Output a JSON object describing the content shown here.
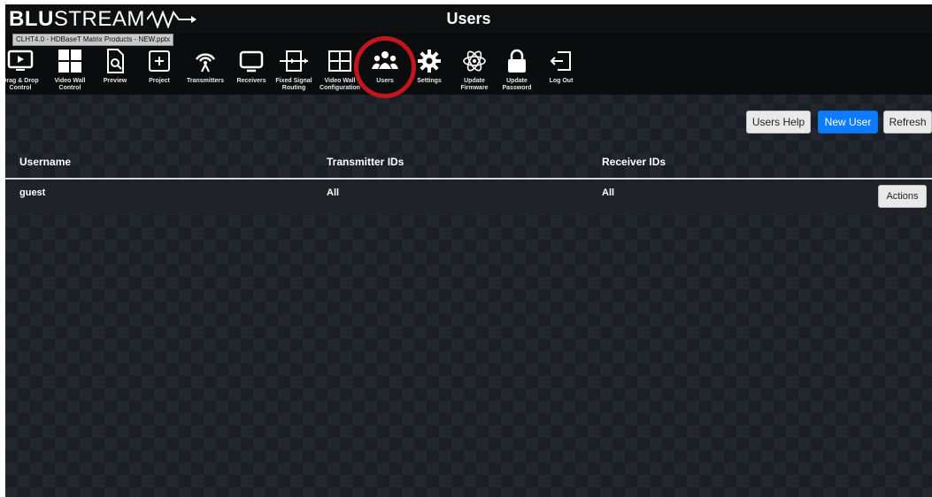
{
  "app": {
    "logo_bold": "BLU",
    "logo_light": "STREAM",
    "page_title": "Users",
    "tooltip": "CLHT4.0 - HDBaseT Matrix Products - NEW.pptx"
  },
  "toolbar": {
    "items": [
      {
        "label": "Drag & Drop\nControl",
        "icon": "play-screen-icon"
      },
      {
        "label": "Video Wall\nControl",
        "icon": "grid-icon"
      },
      {
        "label": "Preview",
        "icon": "document-search-icon"
      },
      {
        "label": "Project",
        "icon": "plus-box-icon"
      },
      {
        "label": "Transmitters",
        "icon": "broadcast-icon"
      },
      {
        "label": "Receivers",
        "icon": "monitor-icon"
      },
      {
        "label": "Fixed Signal\nRouting",
        "icon": "routing-icon"
      },
      {
        "label": "Video Wall\nConfiguration",
        "icon": "window-grid-icon"
      },
      {
        "label": "Users",
        "icon": "users-icon"
      },
      {
        "label": "Settings",
        "icon": "gear-icon"
      },
      {
        "label": "Update\nFirmware",
        "icon": "atom-icon"
      },
      {
        "label": "Update\nPassword",
        "icon": "lock-icon"
      },
      {
        "label": "Log Out",
        "icon": "logout-icon"
      }
    ],
    "active": "Users",
    "highlight_color": "#c2161c"
  },
  "buttons": {
    "help": "Users Help",
    "new_user": "New User",
    "refresh": "Refresh"
  },
  "table": {
    "headers": [
      "Username",
      "Transmitter IDs",
      "Receiver IDs"
    ],
    "rows": [
      {
        "username": "guest",
        "transmitters": "All",
        "receivers": "All",
        "action": "Actions"
      }
    ]
  },
  "colors": {
    "primary": "#0d7bff",
    "background": "#1b1e24"
  }
}
